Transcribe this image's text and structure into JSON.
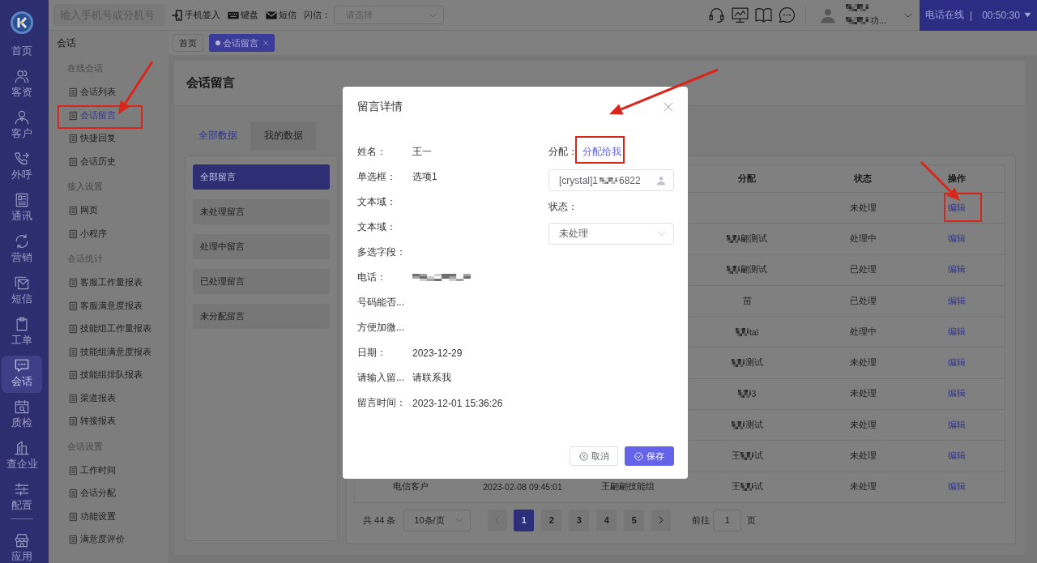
{
  "nav_rail": {
    "items": [
      {
        "label": "首页",
        "selected": false
      },
      {
        "label": "客资",
        "selected": false
      },
      {
        "label": "客户",
        "selected": false
      },
      {
        "label": "外呼",
        "selected": false
      },
      {
        "label": "通讯",
        "selected": false
      },
      {
        "label": "营销",
        "selected": false
      },
      {
        "label": "短信",
        "selected": false
      },
      {
        "label": "工单",
        "selected": false
      },
      {
        "label": "会话",
        "selected": true
      },
      {
        "label": "质检",
        "selected": false
      },
      {
        "label": "查企业",
        "selected": false
      },
      {
        "label": "配置",
        "selected": false
      }
    ],
    "bottom_items": [
      {
        "label": "应用",
        "selected": false
      }
    ]
  },
  "topbar": {
    "search": {
      "placeholder": "输入手机号或分机号"
    },
    "actions": [
      {
        "label": "手机签入"
      },
      {
        "label": "键盘"
      },
      {
        "label": "短信"
      }
    ],
    "flash_message": {
      "label": "闪信：",
      "placeholder": "请选择"
    },
    "user": {
      "name_lines": [
        [
          {
            "kind": "mosaic"
          }
        ],
        [
          {
            "kind": "mosaic"
          },
          {
            "kind": "text",
            "text": "功..."
          }
        ]
      ]
    },
    "call_status": {
      "label": "电话在线",
      "separator": "|",
      "timer": "00:50:30"
    }
  },
  "subnav": {
    "title": "会话",
    "groups": [
      {
        "title": "在线会话",
        "items": [
          {
            "label": "会话列表",
            "selected": false
          },
          {
            "label": "会话留言",
            "selected": true
          },
          {
            "label": "快捷回复",
            "selected": false
          },
          {
            "label": "会话历史",
            "selected": false
          }
        ]
      },
      {
        "title": "接入设置",
        "items": [
          {
            "label": "网页",
            "selected": false
          },
          {
            "label": "小程序",
            "selected": false
          }
        ]
      },
      {
        "title": "会话统计",
        "items": [
          {
            "label": "客服工作量报表",
            "selected": false
          },
          {
            "label": "客服满意度报表",
            "selected": false
          },
          {
            "label": "技能组工作量报表",
            "selected": false
          },
          {
            "label": "技能组满意度报表",
            "selected": false
          },
          {
            "label": "技能组排队报表",
            "selected": false
          },
          {
            "label": "渠道报表",
            "selected": false
          },
          {
            "label": "转接报表",
            "selected": false
          }
        ]
      },
      {
        "title": "会话设置",
        "items": [
          {
            "label": "工作时间",
            "selected": false
          },
          {
            "label": "会话分配",
            "selected": false
          },
          {
            "label": "功能设置",
            "selected": false
          },
          {
            "label": "满意度评价",
            "selected": false
          }
        ]
      }
    ]
  },
  "tabs": [
    {
      "label": "首页",
      "selected": false,
      "closable": false
    },
    {
      "label": "会话留言",
      "selected": true,
      "closable": true
    }
  ],
  "page": {
    "title": "会话留言",
    "data_tabs": [
      {
        "label": "全部数据",
        "selected": true
      },
      {
        "label": "我的数据",
        "selected": false
      }
    ],
    "filters": [
      {
        "label": "全部留言",
        "selected": true
      },
      {
        "label": "未处理留言",
        "selected": false
      },
      {
        "label": "处理中留言",
        "selected": false
      },
      {
        "label": "已处理留言",
        "selected": false
      },
      {
        "label": "未分配留言",
        "selected": false
      }
    ],
    "table": {
      "columns": [
        "分配",
        "状态",
        "操作"
      ],
      "rows": [
        {
          "status": "未处理",
          "action": "编辑"
        },
        {
          "assignee": [
            {
              "kind": "mosaic"
            },
            {
              "kind": "text",
              "text": "翩测试"
            }
          ],
          "status": "处理中",
          "action": "编辑"
        },
        {
          "assignee": [
            {
              "kind": "mosaic"
            },
            {
              "kind": "text",
              "text": "翩测试"
            }
          ],
          "status": "已处理",
          "action": "编辑"
        },
        {
          "assignee": [
            {
              "kind": "text",
              "text": "苗"
            }
          ],
          "status": "已处理",
          "action": "编辑"
        },
        {
          "assignee": [
            {
              "kind": "mosaic"
            },
            {
              "kind": "text",
              "text": "tal"
            }
          ],
          "status": "处理中",
          "action": "编辑"
        },
        {
          "assignee": [
            {
              "kind": "mosaic"
            },
            {
              "kind": "text",
              "text": "测试"
            }
          ],
          "status": "未处理",
          "action": "编辑"
        },
        {
          "assignee": [
            {
              "kind": "mosaic"
            },
            {
              "kind": "text",
              "text": "3"
            }
          ],
          "status": "未处理",
          "action": "编辑"
        },
        {
          "assignee": [
            {
              "kind": "mosaic"
            },
            {
              "kind": "text",
              "text": "测试"
            }
          ],
          "status": "未处理",
          "action": "编辑"
        },
        {
          "assignee": [
            {
              "kind": "text",
              "text": "王"
            },
            {
              "kind": "mosaic"
            },
            {
              "kind": "text",
              "text": "试"
            }
          ],
          "status": "未处理",
          "action": "编辑"
        },
        {
          "column_1": "电信客户",
          "column_2": "2023-02-08 09:45:01",
          "column_3": "王翩翩技能组",
          "assignee": [
            {
              "kind": "text",
              "text": "王"
            },
            {
              "kind": "mosaic"
            },
            {
              "kind": "text",
              "text": "试"
            }
          ],
          "status": "未处理",
          "action": "编辑"
        }
      ]
    },
    "pagination": {
      "total": "共 44 条",
      "page_size": "10条/页",
      "prev_disabled": true,
      "pages": [
        {
          "label": "1",
          "selected": true
        },
        {
          "label": "2",
          "selected": false
        },
        {
          "label": "3",
          "selected": false
        },
        {
          "label": "4",
          "selected": false
        },
        {
          "label": "5",
          "selected": false
        }
      ],
      "next_disabled": false,
      "goto_label": "前往",
      "goto_value": "1",
      "goto_suffix": "页"
    }
  },
  "dialog": {
    "title": "留言详情",
    "fields": [
      {
        "label": "姓名：",
        "value": "王一"
      },
      {
        "label": "单选框：",
        "value": "选项1"
      },
      {
        "label": "文本域："
      },
      {
        "label": "文本域："
      },
      {
        "label": "多选字段："
      },
      {
        "label": "电话：",
        "value": [
          {
            "kind": "mosaic"
          }
        ]
      },
      {
        "label": "号码能否..."
      },
      {
        "label": "方便加微..."
      },
      {
        "label": "日期：",
        "value": "2023-12-29"
      },
      {
        "label": "请输入留...",
        "value": "请联系我"
      },
      {
        "label": "留言时间：",
        "value": "2023-12-01 15:36:26"
      }
    ],
    "assign": {
      "label": "分配：",
      "link": "分配给我",
      "value": [
        {
          "kind": "text",
          "text": "[crystal]1"
        },
        {
          "kind": "mosaic"
        },
        {
          "kind": "text",
          "text": "6822"
        }
      ]
    },
    "status": {
      "label": "状态：",
      "value": "未处理"
    },
    "buttons": [
      {
        "label": "取消",
        "kind": "secondary"
      },
      {
        "label": "保存",
        "kind": "primary"
      }
    ]
  }
}
